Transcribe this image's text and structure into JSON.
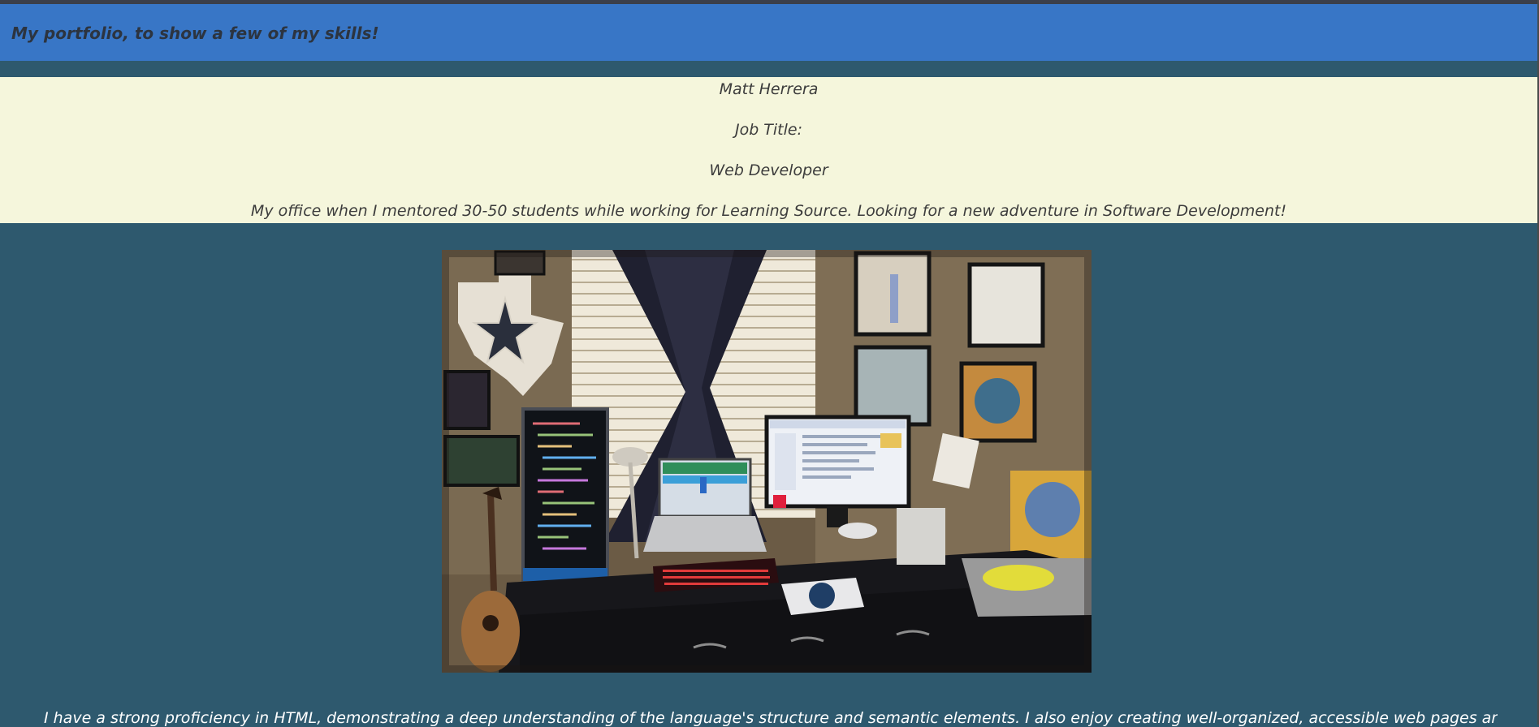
{
  "header": {
    "title": "My portfolio, to show a few of my skills!"
  },
  "profile": {
    "name": "Matt Herrera",
    "job_title_label": "Job Title:",
    "job_title": "Web Developer",
    "photo_caption": "My office when I mentored 30-50 students while working for Learning Source. Looking for a new adventure in Software Development!"
  },
  "about": {
    "text": "I have a strong proficiency in HTML, demonstrating a deep understanding of the language's structure and semantic elements. I also enjoy creating well-organized, accessible web pages and the"
  },
  "colors": {
    "header_bg": "#3876c6",
    "page_bg": "#2e596e",
    "info_band_bg": "#f5f6dc",
    "header_text": "#2c3440",
    "bio_text": "#ffffff"
  }
}
